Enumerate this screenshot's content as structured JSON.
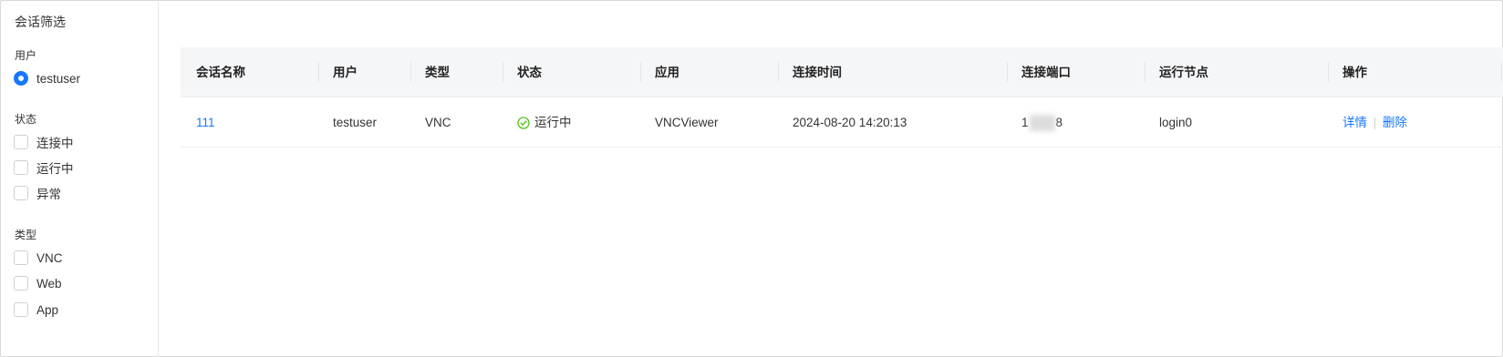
{
  "sidebar": {
    "title": "会话筛选",
    "user_group": {
      "label": "用户",
      "options": [
        {
          "label": "testuser",
          "selected": true
        }
      ]
    },
    "status_group": {
      "label": "状态",
      "options": [
        {
          "label": "连接中"
        },
        {
          "label": "运行中"
        },
        {
          "label": "异常"
        }
      ]
    },
    "type_group": {
      "label": "类型",
      "options": [
        {
          "label": "VNC"
        },
        {
          "label": "Web"
        },
        {
          "label": "App"
        }
      ]
    }
  },
  "table": {
    "columns": [
      "会话名称",
      "用户",
      "类型",
      "状态",
      "应用",
      "连接时间",
      "连接端口",
      "运行节点",
      "操作"
    ],
    "rows": [
      {
        "name": "111",
        "user": "testuser",
        "type": "VNC",
        "status": "运行中",
        "app": "VNCViewer",
        "connect_time": "2024-08-20 14:20:13",
        "port_start": "1",
        "port_end": "8",
        "node": "login0",
        "actions": {
          "detail": "详情",
          "delete": "删除"
        }
      }
    ]
  },
  "colors": {
    "accent": "#1677ff",
    "success": "#52c41a",
    "header_bg": "#f5f6f8"
  }
}
